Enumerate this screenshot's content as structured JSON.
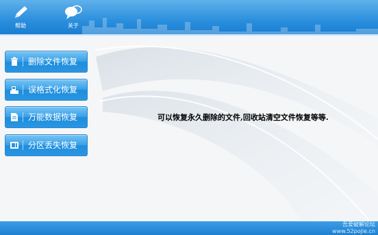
{
  "toolbar": {
    "help_label": "帮助",
    "about_label": "关于"
  },
  "sidebar": {
    "items": [
      {
        "label": "删除文件恢复",
        "icon": "trash-icon"
      },
      {
        "label": "误格式化恢复",
        "icon": "format-drive-icon"
      },
      {
        "label": "万能数据恢复",
        "icon": "document-icon"
      },
      {
        "label": "分区丢失恢复",
        "icon": "partition-icon"
      }
    ]
  },
  "main": {
    "description": "可以恢复永久删除的文件,回收站清空文件恢复等等."
  },
  "watermark": {
    "line1": "吾爱破解论坛",
    "line2": "www.52pojie.cn"
  },
  "colors": {
    "accent": "#2a96e2",
    "toolbar": "#2b8fdd",
    "background": "#f4f6f8"
  }
}
